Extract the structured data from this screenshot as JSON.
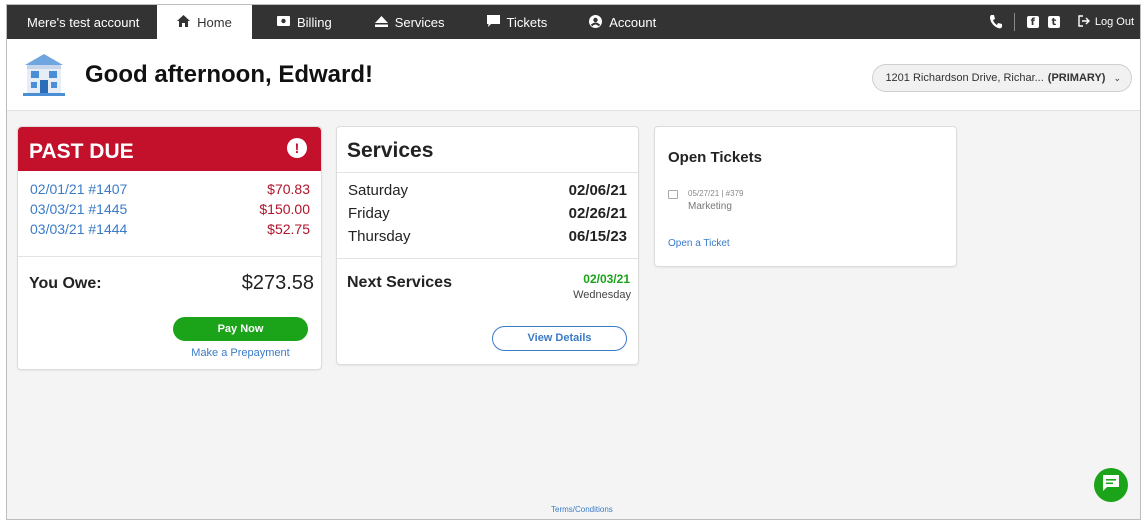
{
  "nav": {
    "account": "Mere's test account",
    "home": "Home",
    "billing": "Billing",
    "services": "Services",
    "tickets": "Tickets",
    "account_tab": "Account",
    "logout": "Log Out",
    "icons": {
      "phone": "phone-icon",
      "facebook": "facebook-icon",
      "twitter": "twitter-icon"
    }
  },
  "header": {
    "greeting": "Good afternoon, Edward!",
    "address": "1201 Richardson Drive, Richar...",
    "address_tag": "(PRIMARY)"
  },
  "past_due": {
    "title": "PAST DUE",
    "invoices": [
      {
        "label": "02/01/21 #1407",
        "amount": "$70.83"
      },
      {
        "label": "03/03/21 #1445",
        "amount": "$150.00"
      },
      {
        "label": "03/03/21 #1444",
        "amount": "$52.75"
      }
    ],
    "owe_label": "You Owe:",
    "owe_amount": "$273.58",
    "pay_button": "Pay Now",
    "prepay_link": "Make a Prepayment"
  },
  "services": {
    "title": "Services",
    "rows": [
      {
        "day": "Saturday",
        "date": "02/06/21"
      },
      {
        "day": "Friday",
        "date": "02/26/21"
      },
      {
        "day": "Thursday",
        "date": "06/15/23"
      }
    ],
    "next_label": "Next Services",
    "next_date": "02/03/21",
    "next_day": "Wednesday",
    "view_button": "View Details"
  },
  "tickets": {
    "title": "Open Tickets",
    "items": [
      {
        "meta": "05/27/21 | #379",
        "title": "Marketing"
      }
    ],
    "open_link": "Open a Ticket"
  },
  "footer": {
    "terms": "Terms/Conditions"
  },
  "colors": {
    "nav_bg": "#333333",
    "past_due_red": "#c3102b",
    "amount_red": "#b0132a",
    "link_blue": "#3a7bc8",
    "green": "#1ba319"
  }
}
